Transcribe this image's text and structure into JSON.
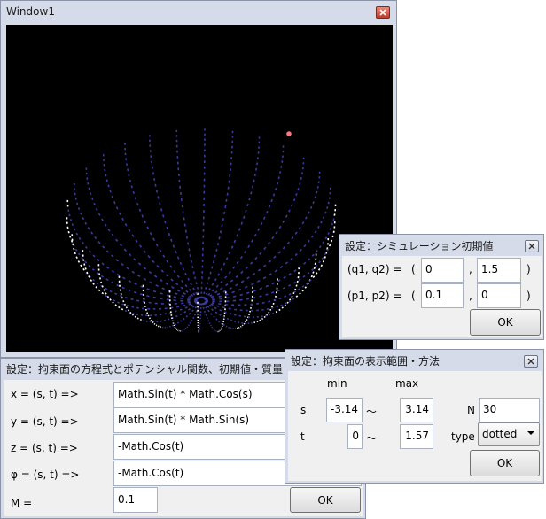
{
  "main_window": {
    "title": "Window1"
  },
  "sim_dialog": {
    "title": "設定：シミュレーション初期値",
    "q_label": "(q1, q2) =",
    "p_label": "(p1, p2) =",
    "open_paren": "(",
    "comma": ",",
    "close_paren": ")",
    "q1": "0",
    "q2": "1.5",
    "p1": "0.1",
    "p2": "0",
    "ok_label": "OK"
  },
  "eq_dialog": {
    "title": "設定：拘束面の方程式とポテンシャル関数、初期値・質量",
    "rows": [
      {
        "label": "x = (s, t) =>",
        "value": "Math.Sin(t) * Math.Cos(s)"
      },
      {
        "label": "y = (s, t) =>",
        "value": "Math.Sin(t) * Math.Sin(s)"
      },
      {
        "label": "z = (s, t) =>",
        "value": "-Math.Cos(t)"
      },
      {
        "label": "φ = (s, t) =>",
        "value": "-Math.Cos(t)"
      }
    ],
    "mass_label": "M =",
    "mass_value": "0.1",
    "ok_label": "OK"
  },
  "range_dialog": {
    "title": "設定：拘束面の表示範囲・方法",
    "min_header": "min",
    "max_header": "max",
    "s_label": "s",
    "t_label": "t",
    "tilde": "〜",
    "s_min": "-3.14",
    "s_max": "3.14",
    "t_min": "0",
    "t_max": "1.57",
    "n_label": "N",
    "n_value": "30",
    "type_label": "type",
    "type_value": "dotted",
    "ok_label": "OK"
  },
  "colors": {
    "canvas_bg": "#000000",
    "dots": "#ffffff",
    "particle": "#ff7777",
    "dialog_chrome": "#d6dbe9"
  }
}
